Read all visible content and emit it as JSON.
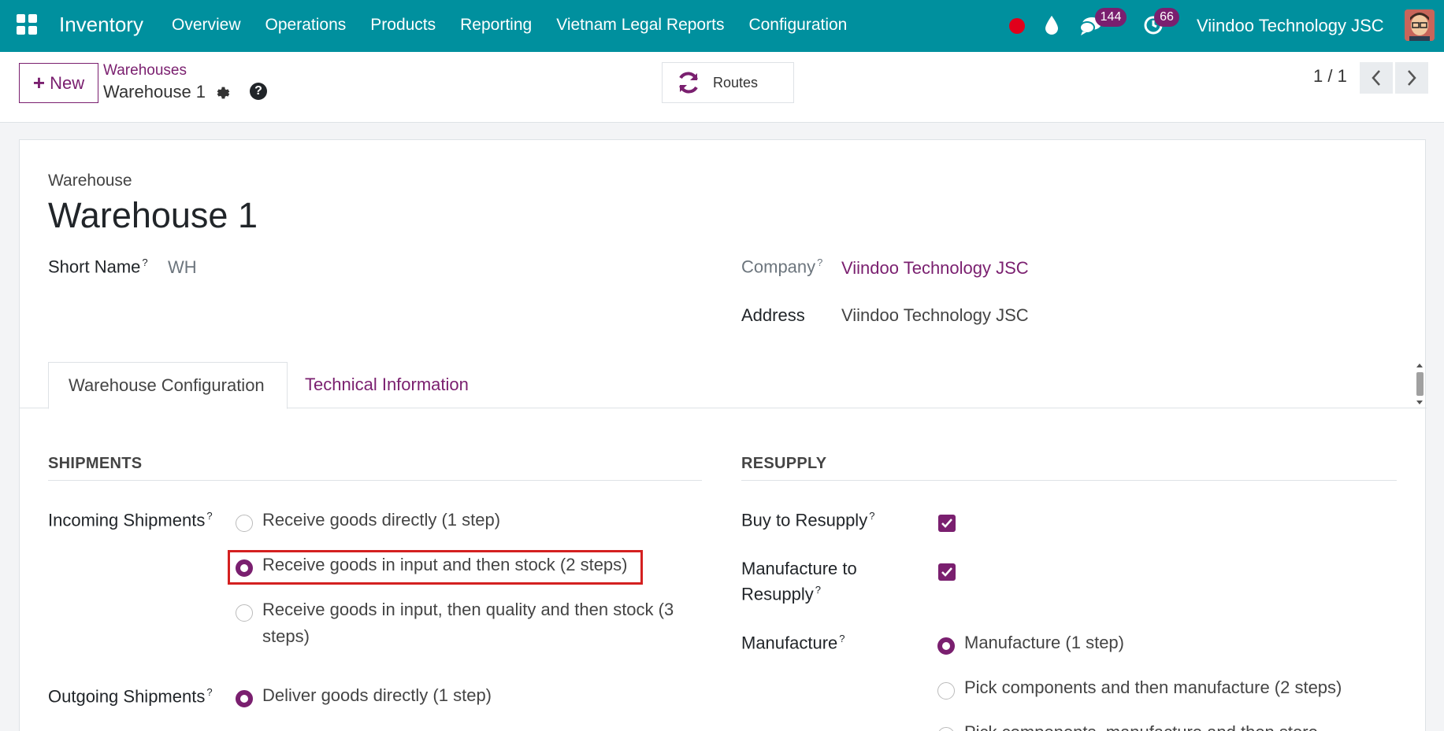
{
  "topnav": {
    "app_title": "Inventory",
    "menu": [
      "Overview",
      "Operations",
      "Products",
      "Reporting",
      "Vietnam Legal Reports",
      "Configuration"
    ],
    "messages_count": "144",
    "activities_count": "66",
    "company": "Viindoo Technology JSC",
    "accent_color": "#00909e"
  },
  "control_panel": {
    "new_label": "New",
    "breadcrumb_parent": "Warehouses",
    "breadcrumb_current": "Warehouse 1",
    "routes_label": "Routes",
    "pager": "1 / 1"
  },
  "form": {
    "label": "Warehouse",
    "title": "Warehouse 1",
    "short_name_label": "Short Name",
    "short_name_help": "?",
    "short_name_value": "WH",
    "company_label": "Company",
    "company_help": "?",
    "company_value": "Viindoo Technology JSC",
    "address_label": "Address",
    "address_value": "Viindoo Technology JSC",
    "tabs": [
      "Warehouse Configuration",
      "Technical Information"
    ],
    "shipments": {
      "title": "SHIPMENTS",
      "incoming_label": "Incoming Shipments",
      "incoming_help": "?",
      "incoming_options": [
        {
          "label": "Receive goods directly (1 step)",
          "checked": false
        },
        {
          "label": "Receive goods in input and then stock (2 steps)",
          "checked": true
        },
        {
          "label_line1": "Receive goods in input, then quality and then stock (3",
          "label_line2": "steps)",
          "checked": false
        }
      ],
      "outgoing_label": "Outgoing Shipments",
      "outgoing_help": "?",
      "outgoing_options": [
        {
          "label": "Deliver goods directly (1 step)",
          "checked": true
        }
      ]
    },
    "resupply": {
      "title": "RESUPPLY",
      "buy_label": "Buy to Resupply",
      "buy_help": "?",
      "buy_checked": true,
      "manufacture_resupply_line1": "Manufacture to",
      "manufacture_resupply_line2": "Resupply",
      "manufacture_resupply_help": "?",
      "manufacture_resupply_checked": true,
      "manufacture_label": "Manufacture",
      "manufacture_help": "?",
      "manufacture_options": [
        {
          "label": "Manufacture (1 step)",
          "checked": true
        },
        {
          "label": "Pick components and then manufacture (2 steps)",
          "checked": false
        },
        {
          "label": "Pick components, manufacture and then store",
          "checked": false
        }
      ]
    }
  }
}
